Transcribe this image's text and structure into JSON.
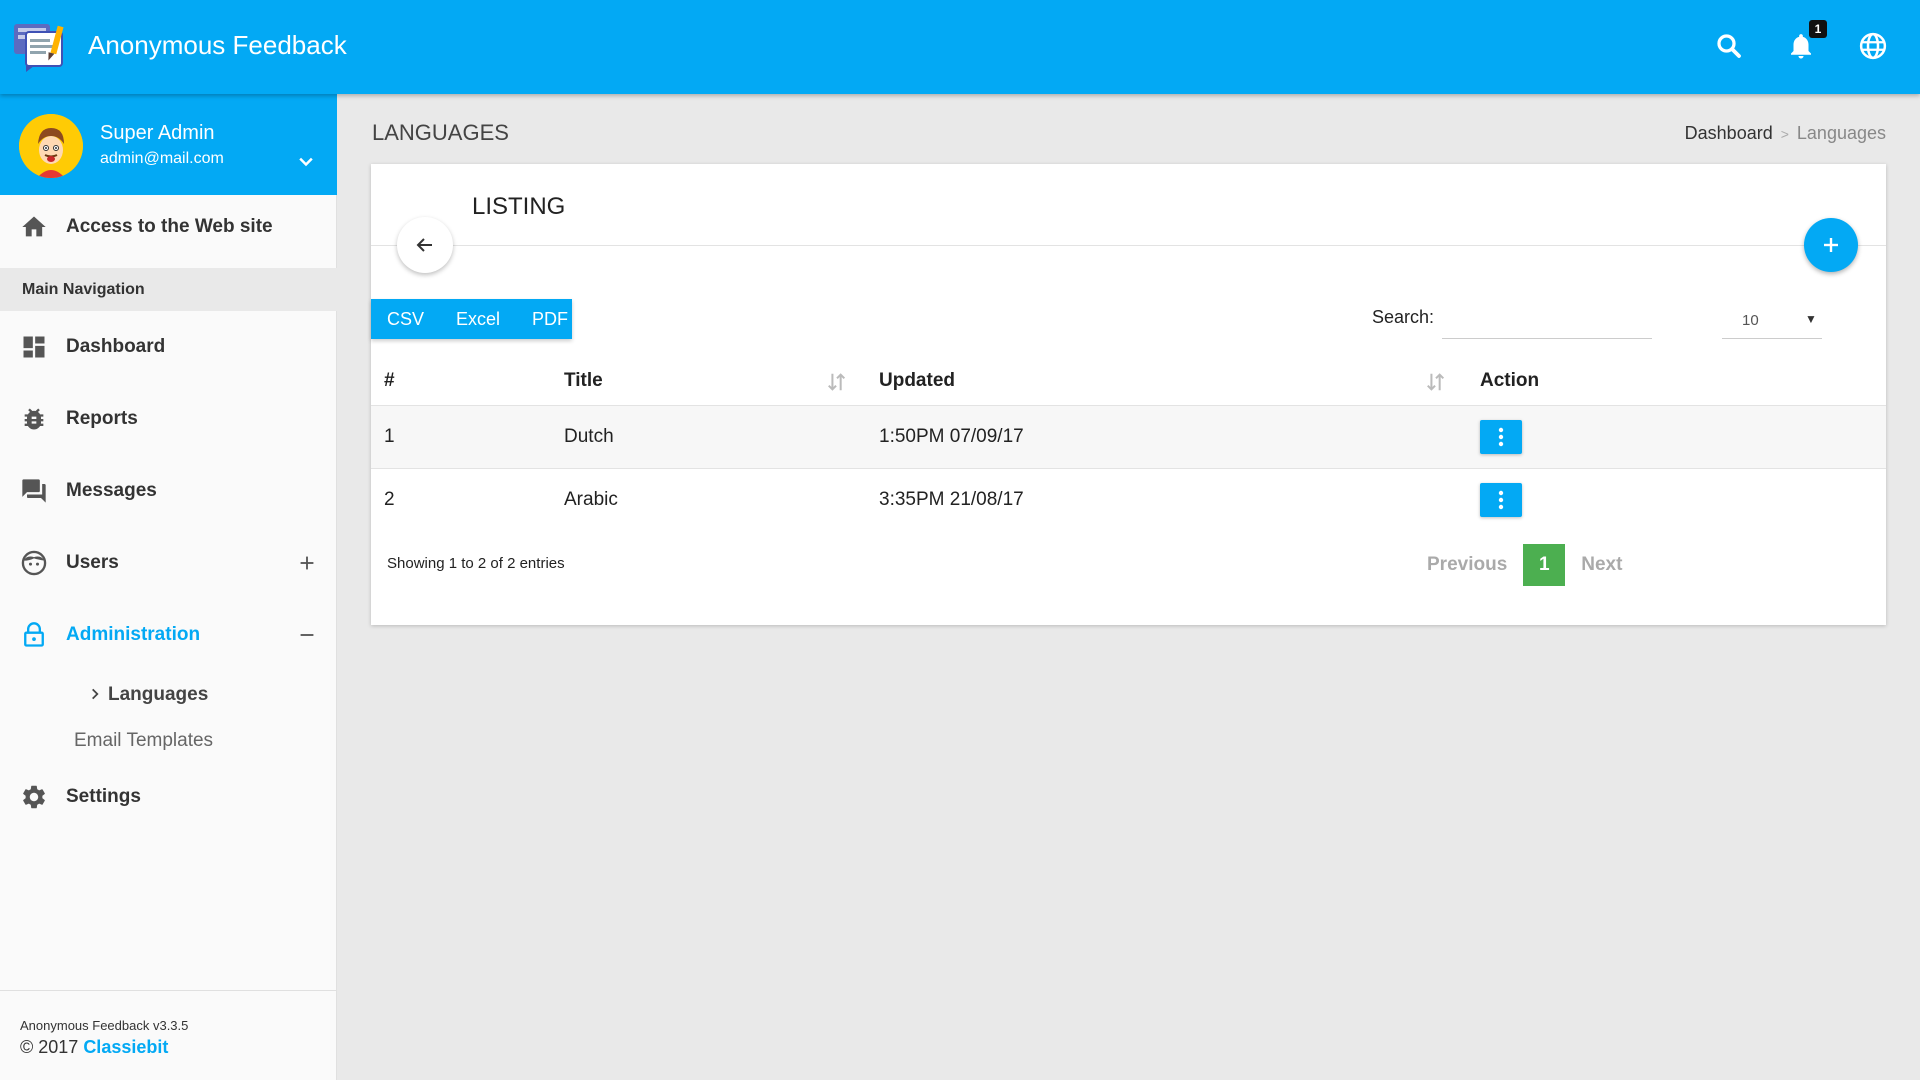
{
  "header": {
    "app_title": "Anonymous Feedback",
    "logo_icon": "feedback-logo",
    "search_icon": "search-icon",
    "notifications_icon": "bell-icon",
    "notifications_count": "1",
    "language_icon": "globe-icon",
    "accent_color": "#03a9f4"
  },
  "user": {
    "name": "Super Admin",
    "email": "admin@mail.com"
  },
  "sidebar": {
    "access_site": "Access to the Web site",
    "section_header": "Main Navigation",
    "items": [
      {
        "label": "Dashboard",
        "icon": "dashboard-icon"
      },
      {
        "label": "Reports",
        "icon": "bug-icon"
      },
      {
        "label": "Messages",
        "icon": "chat-icon"
      },
      {
        "label": "Users",
        "icon": "face-icon"
      },
      {
        "label": "Administration",
        "icon": "lock-icon"
      }
    ],
    "sub_items": [
      "Languages",
      "Email Templates"
    ],
    "settings": "Settings",
    "footer_version": "Anonymous Feedback v3.3.5",
    "footer_copyright": "© 2017 ",
    "footer_brand": "Classiebit"
  },
  "page": {
    "title": "LANGUAGES",
    "breadcrumb": [
      "Dashboard",
      "Languages"
    ],
    "breadcrumb_sep": ">"
  },
  "card": {
    "title": "LISTING",
    "export_buttons": [
      "CSV",
      "Excel",
      "PDF"
    ],
    "search_label": "Search:",
    "search_value": "",
    "page_size": "10",
    "columns": [
      "#",
      "Title",
      "Updated",
      "Action"
    ],
    "rows": [
      {
        "num": "1",
        "title": "Dutch",
        "updated": "1:50PM 07/09/17"
      },
      {
        "num": "2",
        "title": "Arabic",
        "updated": "3:35PM 21/08/17"
      }
    ],
    "info": "Showing 1 to 2 of 2 entries",
    "pager": {
      "previous": "Previous",
      "current": "1",
      "next": "Next"
    }
  }
}
